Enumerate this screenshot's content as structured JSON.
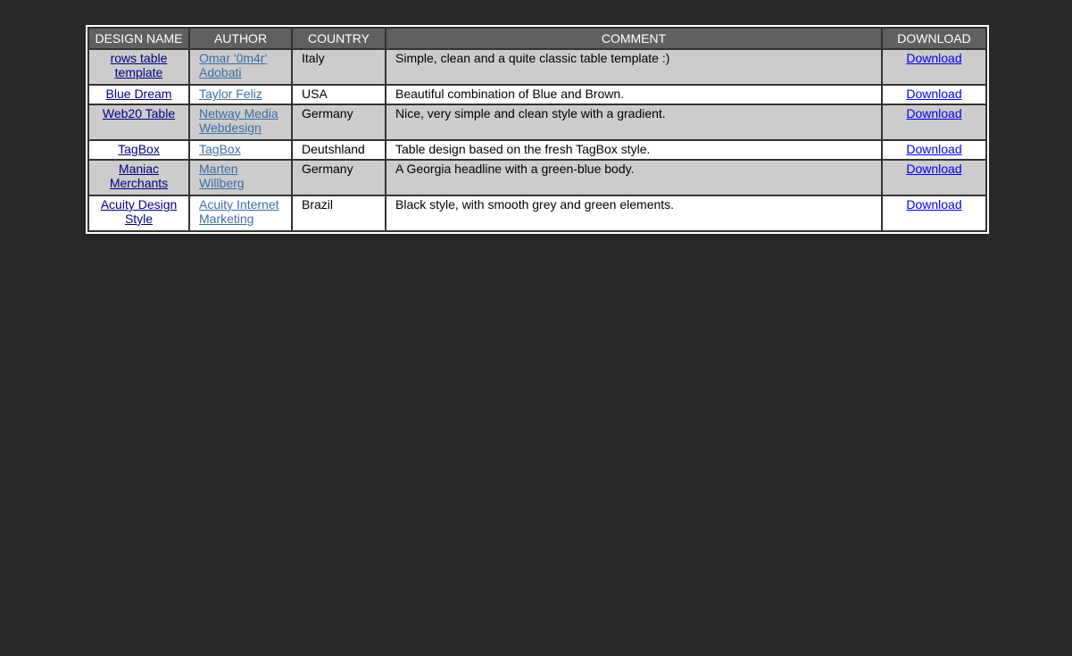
{
  "table": {
    "headers": [
      "DESIGN NAME",
      "AUTHOR",
      "COUNTRY",
      "COMMENT",
      "DOWNLOAD"
    ],
    "rows": [
      {
        "name": "rows table template",
        "author": "Omar '0m4r' Adobati",
        "country": "Italy",
        "comment": "Simple, clean and a quite classic table template :)",
        "download": "Download"
      },
      {
        "name": "Blue Dream",
        "author": "Taylor Feliz",
        "country": "USA",
        "comment": "Beautiful combination of Blue and Brown.",
        "download": "Download"
      },
      {
        "name": "Web20 Table",
        "author": "Netway Media Webdesign",
        "country": "Germany",
        "comment": "Nice, very simple and clean style with a gradient.",
        "download": "Download"
      },
      {
        "name": "TagBox",
        "author": "TagBox",
        "country": "Deutshland",
        "comment": "Table design based on the fresh TagBox style.",
        "download": "Download"
      },
      {
        "name": "Maniac Merchants",
        "author": "Marten Willberg",
        "country": "Germany",
        "comment": "A Georgia headline with a green-blue body.",
        "download": "Download"
      },
      {
        "name": "Acuity Design Style",
        "author": "Acuity Internet Marketing",
        "country": "Brazil",
        "comment": "Black style, with smooth grey and green elements.",
        "download": "Download"
      }
    ]
  },
  "colors": {
    "page_background": "#282828",
    "header_background": "#606060",
    "odd_row": "#cccccc",
    "even_row": "#ffffff",
    "name_link": "#000080",
    "author_link": "#3a6ea5",
    "download_link": "#0000ee"
  }
}
